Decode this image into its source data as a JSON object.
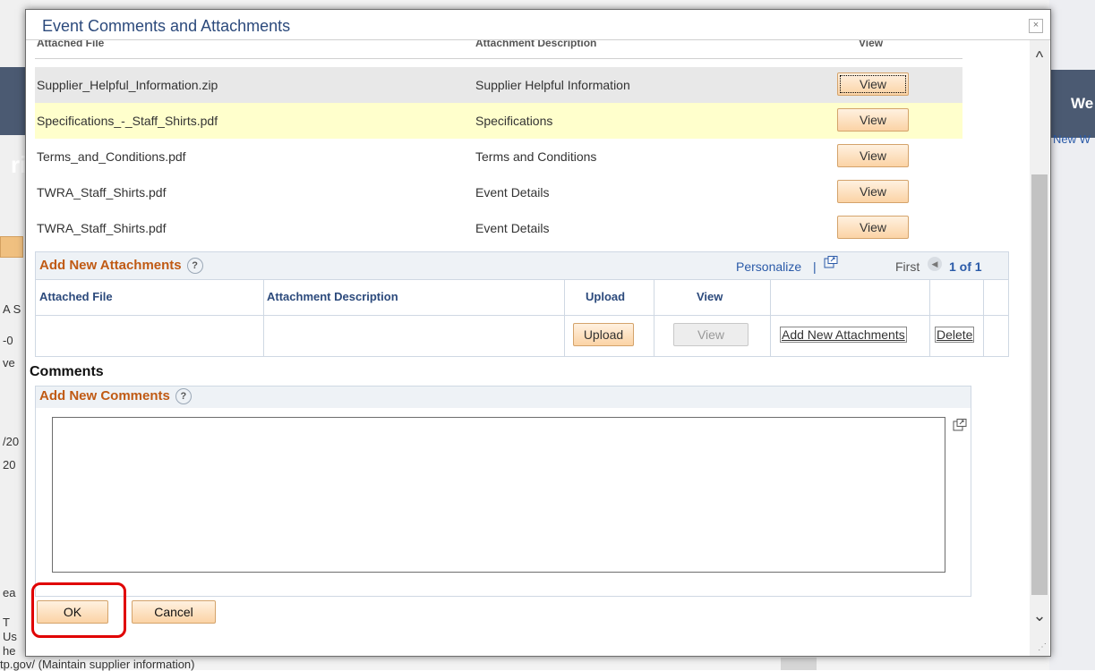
{
  "background": {
    "left_heading_fragment": "ri",
    "right_heading_fragment": "We",
    "right_link_fragment": "New W",
    "left_fragments": [
      "A S",
      "-0",
      "ve",
      "/20",
      "20",
      "ea",
      "T",
      "Us",
      "he"
    ],
    "bottom_text": "tp.gov/ (Maintain supplier information)"
  },
  "modal": {
    "title": "Event Comments and Attachments",
    "close_label": "×"
  },
  "attached_files": {
    "headers": {
      "file": "Attached File",
      "description": "Attachment Description",
      "view": "View"
    },
    "rows": [
      {
        "file": "Supplier_Helpful_Information.zip",
        "description": "Supplier Helpful Information",
        "view_label": "View"
      },
      {
        "file": "Specifications_-_Staff_Shirts.pdf",
        "description": "Specifications",
        "view_label": "View"
      },
      {
        "file": "Terms_and_Conditions.pdf",
        "description": "Terms and Conditions",
        "view_label": "View"
      },
      {
        "file": "TWRA_Staff_Shirts.pdf",
        "description": "Event Details",
        "view_label": "View"
      },
      {
        "file": "TWRA_Staff_Shirts.pdf",
        "description": "Event Details",
        "view_label": "View"
      }
    ]
  },
  "add_attachments": {
    "title": "Add New Attachments",
    "help": "?",
    "personalize": "Personalize",
    "pipe": "|",
    "first": "First",
    "count": "1 of 1",
    "columns": {
      "file": "Attached File",
      "description": "Attachment Description",
      "upload": "Upload",
      "view": "View"
    },
    "row": {
      "upload_label": "Upload",
      "view_label": "View",
      "add_label": "Add New Attachments",
      "delete_label": "Delete"
    }
  },
  "comments": {
    "title": "Comments",
    "section_title": "Add New Comments",
    "help": "?",
    "value": ""
  },
  "footer": {
    "ok_label": "OK",
    "cancel_label": "Cancel"
  },
  "colors": {
    "section_title": "#c05a14",
    "link": "#2a5aa8",
    "button_bg": "#fbd3a5",
    "highlight_row": "#ffffcc",
    "annotation_red": "#e00000"
  },
  "icons": [
    "close-icon",
    "help-icon",
    "popout-icon",
    "previous-arrow-icon",
    "expand-icon",
    "scroll-up-icon",
    "scroll-down-icon",
    "resize-grip-icon"
  ]
}
